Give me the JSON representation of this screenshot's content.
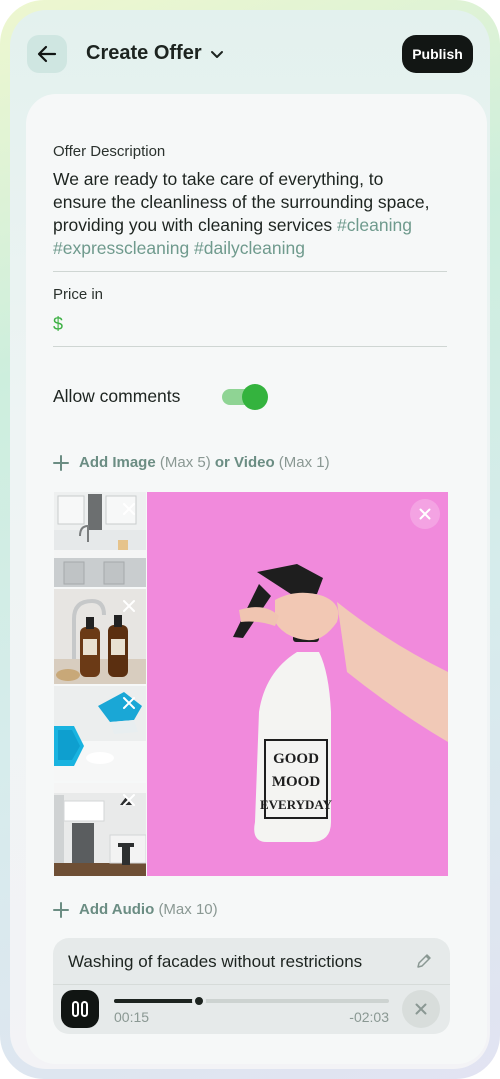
{
  "header": {
    "title": "Create Offer",
    "publish_label": "Publish"
  },
  "description": {
    "label": "Offer Description",
    "text": "We are ready to take care of everything, to ensure the cleanliness of the surrounding space, providing you with cleaning services",
    "hashtags": "#cleaning #expresscleaning #dailycleaning"
  },
  "price": {
    "label": "Price in",
    "currency": "$"
  },
  "comments": {
    "label": "Allow comments",
    "enabled": true
  },
  "media": {
    "add_image_label": "Add Image",
    "image_limit": "(Max 5)",
    "or_video_label": "or Video",
    "video_limit": "(Max 1)",
    "thumbnails": [
      "kitchen",
      "amber-bottles",
      "glove-wiping",
      "kitchen-2"
    ],
    "main_image": {
      "label_lines": [
        "GOOD",
        "MOOD",
        "EVERYDAY"
      ]
    }
  },
  "audio": {
    "add_audio_label": "Add Audio",
    "audio_limit": "(Max 10)",
    "track_title": "Washing of facades without restrictions",
    "current_time": "00:15",
    "remaining_time": "-02:03",
    "progress": 0.31
  },
  "colors": {
    "accent_green": "#34b33e",
    "hashtag": "#6f9a8d",
    "publish_bg": "#121614"
  }
}
